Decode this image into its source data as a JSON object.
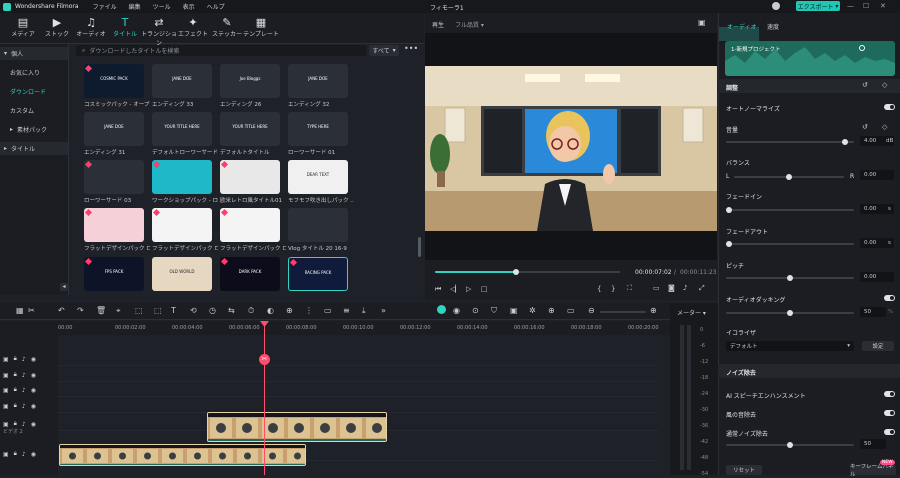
{
  "app": {
    "name": "Wondershare Filmora",
    "menu": [
      "ファイル",
      "編集",
      "ツール",
      "表示",
      "ヘルプ"
    ],
    "project_title": "フィモーラ1",
    "export": "エクスポート"
  },
  "colors": {
    "accent": "#2fd3c0",
    "playhead": "#ff4d6d"
  },
  "toolbar": [
    {
      "label": "メディア",
      "icon": "media-icon"
    },
    {
      "label": "ストック",
      "icon": "stock-icon"
    },
    {
      "label": "オーディオ",
      "icon": "audio-icon"
    },
    {
      "label": "タイトル",
      "icon": "title-icon",
      "active": true
    },
    {
      "label": "トランジション",
      "icon": "transition-icon"
    },
    {
      "label": "エフェクト",
      "icon": "effect-icon"
    },
    {
      "label": "ステッカー",
      "icon": "sticker-icon"
    },
    {
      "label": "テンプレート",
      "icon": "template-icon"
    }
  ],
  "sidebar": [
    {
      "label": "個人"
    },
    {
      "label": "お気に入り"
    },
    {
      "label": "ダウンロード"
    },
    {
      "label": "カスタム"
    },
    {
      "label": "素材パック"
    },
    {
      "label": "タイトル"
    }
  ],
  "search": {
    "placeholder": "ダウンロードしたタイトルを検索",
    "filter": "すべて"
  },
  "titles": [
    {
      "label": "コスミックパック - オープナー",
      "thumb": "COSMIC PACK"
    },
    {
      "label": "エンディング 33",
      "thumb": "JANE DOE"
    },
    {
      "label": "エンディング 26",
      "thumb": "Joe Bloggs"
    },
    {
      "label": "エンディング 32",
      "thumb": "JANE DOE"
    },
    {
      "label": "エンディング 31",
      "thumb": "JANE DOE"
    },
    {
      "label": "デフォルトローワーサード",
      "thumb": "YOUR TITLE HERE"
    },
    {
      "label": "デフォルトタイトル",
      "thumb": "YOUR TITLE HERE"
    },
    {
      "label": "ローワーサード 01",
      "thumb": "TYPE HERE"
    },
    {
      "label": "ローワーサード 03",
      "thumb": ""
    },
    {
      "label": "ワークショップパック - ローワ...",
      "thumb": ""
    },
    {
      "label": "欧米レトロ風タイトル01",
      "thumb": ""
    },
    {
      "label": "モフモフ吹き出しパック ...",
      "thumb": "DEAR TEXT"
    },
    {
      "label": "フラットデザインパック ロー...",
      "thumb": ""
    },
    {
      "label": "フラットデザインパック ロー...",
      "thumb": ""
    },
    {
      "label": "フラットデザインパック ロー...",
      "thumb": ""
    },
    {
      "label": "Vlog タイトル 20 16-9",
      "thumb": ""
    },
    {
      "label": "",
      "thumb": "FPS PACK"
    },
    {
      "label": "",
      "thumb": "OLD WORLD"
    },
    {
      "label": "",
      "thumb": "DARK PACK"
    },
    {
      "label": "",
      "thumb": "RACING PACK"
    }
  ],
  "preview": {
    "tab": "再生",
    "quality": "フル品質",
    "time_current": "00:00:07:02",
    "time_total": "00:00:11:23",
    "progress": 0.44
  },
  "right": {
    "tabs": [
      "オーディオ",
      "速度"
    ],
    "project": "1-新規プロジェクト",
    "adjust": "調整",
    "normalize": "オートノーマライズ",
    "volume": "音量",
    "volume_val": "4.00",
    "volume_unit": "dB",
    "balance": "バランス",
    "balance_l": "L",
    "balance_r": "R",
    "balance_val": "0.00",
    "fadein": "フェードイン",
    "fadein_val": "0.00",
    "fadeout": "フェードアウト",
    "fadeout_val": "0.00",
    "pitch": "ピッチ",
    "pitch_val": "0.00",
    "ducking": "オーディオダッキング",
    "ducking_val": "50",
    "ducking_unit": "%",
    "eq": "イコライザ",
    "eq_val": "デフォルト",
    "eq_btn": "設定",
    "noise": "ノイズ除去",
    "ai_enhance": "AI スピーチエンハンスメント",
    "wind": "風の音除去",
    "normal_noise": "通常ノイズ除去",
    "noise_val": "50",
    "reset": "リセット",
    "keyframe": "キーフレームパネル",
    "new_badge": "NEW",
    "sec": "s"
  },
  "timeline": {
    "ticks": [
      "00:00",
      "00:00:02:00",
      "00:00:04:00",
      "00:00:06:00",
      "00:00:08:00",
      "00:00:10:00",
      "00:00:12:00",
      "00:00:14:00",
      "00:00:16:00",
      "00:00:18:00",
      "00:00:20:00"
    ],
    "meter_label": "メーター",
    "meter_ticks": [
      "0",
      "-6",
      "-12",
      "-18",
      "-24",
      "-30",
      "-36",
      "-42",
      "-48",
      "-54"
    ],
    "track_label": "ビデオ 2",
    "playhead_time": "00:00:07:02"
  }
}
